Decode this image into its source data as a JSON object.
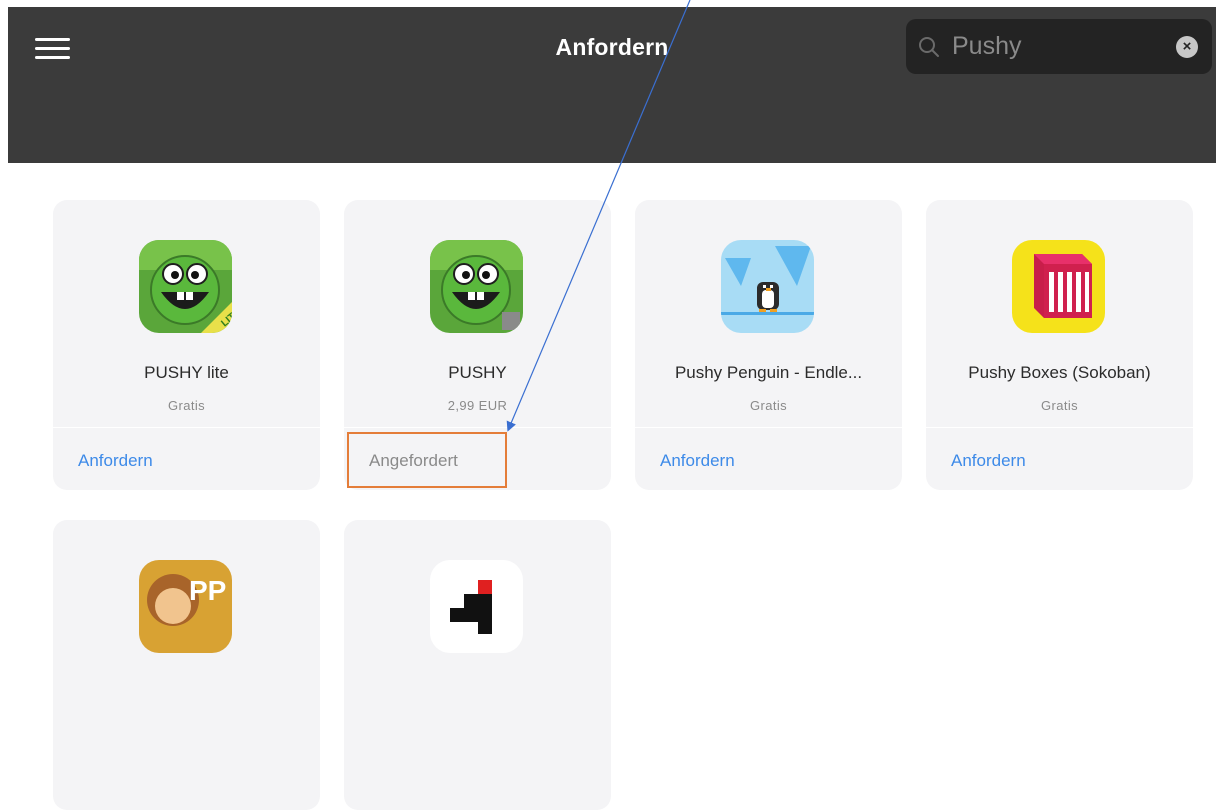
{
  "header": {
    "title": "Anfordern",
    "search": {
      "value": "Pushy",
      "clear_icon": "clear-icon"
    }
  },
  "apps": [
    {
      "name": "PUSHY lite",
      "price": "Gratis",
      "action": "Anfordern",
      "icon": "pushy-lite-icon",
      "state": "available"
    },
    {
      "name": "PUSHY",
      "price": "2,99 EUR",
      "action": "Angefordert",
      "icon": "pushy-icon",
      "state": "requested"
    },
    {
      "name": "Pushy Penguin - Endle...",
      "price": "Gratis",
      "action": "Anfordern",
      "icon": "pushy-penguin-icon",
      "state": "available"
    },
    {
      "name": "Pushy Boxes (Sokoban)",
      "price": "Gratis",
      "action": "Anfordern",
      "icon": "pushy-boxes-icon",
      "state": "available"
    }
  ],
  "partial_apps": [
    {
      "icon": "pp-app-icon",
      "icon_text": "PP"
    },
    {
      "icon": "pixel-app-icon"
    }
  ],
  "colors": {
    "header_bg": "#3b3b3b",
    "accent": "#3d8ae8",
    "card_bg": "#f4f4f6",
    "annotation": "#e47d39",
    "arrow": "#3a6fd1"
  }
}
